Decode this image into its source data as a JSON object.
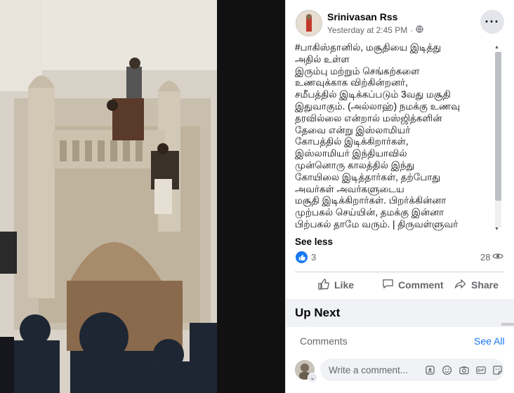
{
  "post": {
    "author": "Srinivasan Rss",
    "timestamp": "Yesterday at 2:45 PM",
    "dot": "·",
    "privacy_icon": "globe-icon",
    "more_label": "···",
    "text_lines": [
      "#பாகிஸ்தானில், மசூதியை இடித்து",
      "அதில் உள்ள",
      "இரும்பு மற்றும் செங்கற்களை",
      "உணவுக்காக விற்கின்றனர்,",
      "சமீபத்தில் இடிக்கப்படும் 3வது மசூதி",
      "இதுவாகும். (அல்லாஹ்) நமக்கு உணவு",
      "தரவில்லை என்றால் மஸ்ஜித்களின்",
      "தேவை என்று இஸ்லாமியர்",
      "கோபத்தில் இடிக்கிறார்கள்,",
      "இஸ்லாமியர் இந்தியாவில்",
      "முன்னொரு காலத்தில் இந்து",
      "கோயிலை இடித்தார்கள், தற்போது",
      "அவர்கள் அவர்களுடைய",
      "மசூதி இடிக்கிறார்கள். பிறர்க்கின்னா",
      "முற்பகல் செய்யின், தமக்கு இன்னா",
      "பிற்பகல் தாமே வரும். | திருவள்ளுவர்"
    ],
    "see_less": "See less",
    "reaction_count": "3",
    "view_count": "28"
  },
  "actions": {
    "like": "Like",
    "comment": "Comment",
    "share": "Share"
  },
  "up_next": {
    "title": "Up Next"
  },
  "comments": {
    "label": "Comments",
    "see_all": "See All",
    "placeholder": "Write a comment..."
  },
  "colors": {
    "brand_blue": "#1877f2",
    "secondary_text": "#65676b"
  }
}
